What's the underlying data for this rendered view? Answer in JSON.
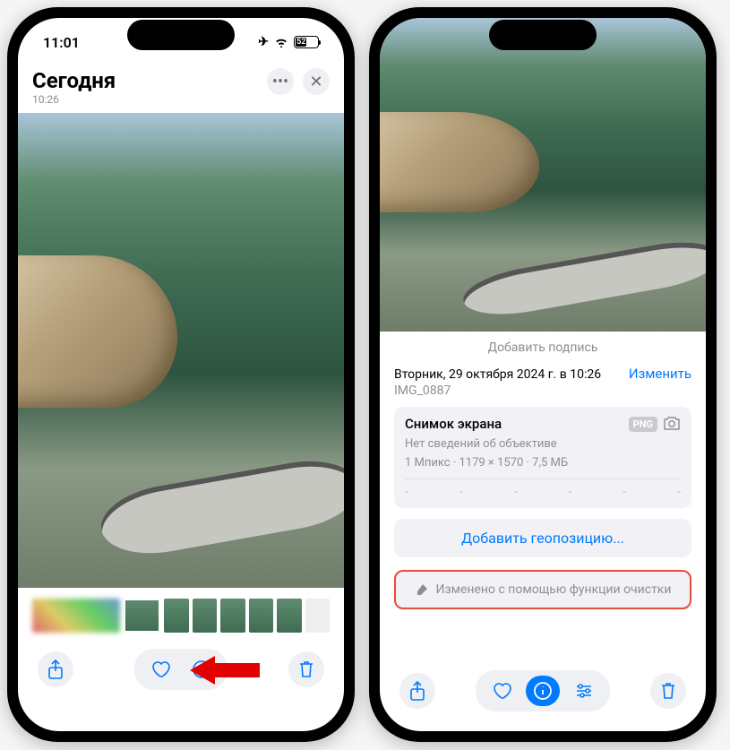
{
  "left": {
    "status": {
      "time": "11:01",
      "battery_pct": "52"
    },
    "header": {
      "title": "Сегодня",
      "subtitle": "10:26"
    }
  },
  "right": {
    "caption_placeholder": "Добавить подпись",
    "info": {
      "date": "Вторник, 29 октября 2024 г. в 10:26",
      "edit": "Изменить",
      "filename": "IMG_0887"
    },
    "card": {
      "title": "Снимок экрана",
      "format": "PNG",
      "lens": "Нет сведений об объективе",
      "meta": "1 Мпикс · 1179 × 1570 · 7,5 МБ",
      "ticks": [
        "-",
        "-",
        "-",
        "-",
        "-",
        "-"
      ]
    },
    "geo_button": "Добавить геопозицию...",
    "cleanup": "Изменено с помощью функции очистки"
  }
}
